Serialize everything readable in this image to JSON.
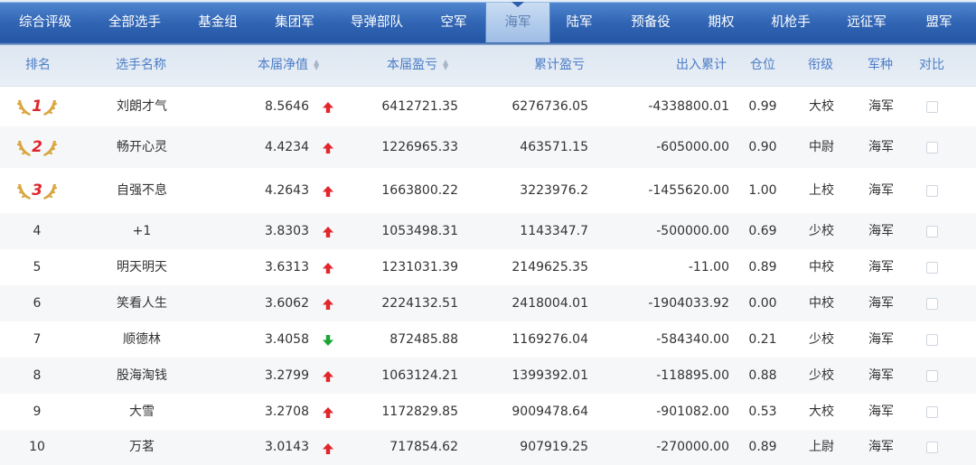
{
  "nav": {
    "items": [
      "综合评级",
      "全部选手",
      "基金组",
      "集团军",
      "导弹部队",
      "空军",
      "海军",
      "陆军",
      "预备役",
      "期权",
      "机枪手",
      "远征军",
      "盟军"
    ],
    "active_index": 6
  },
  "columns": {
    "rank": "排名",
    "name": "选手名称",
    "nav_value": "本届净值",
    "profit": "本届盈亏",
    "total_profit": "累计盈亏",
    "flow": "出入累计",
    "position": "仓位",
    "title": "衔级",
    "branch": "军种",
    "compare": "对比"
  },
  "rows": [
    {
      "rank": "1",
      "name": "刘朗才气",
      "nav": "8.5646",
      "trend": "up",
      "profit": "6412721.35",
      "total": "6276736.05",
      "flow": "-4338800.01",
      "pos": "0.99",
      "title": "大校",
      "branch": "海军"
    },
    {
      "rank": "2",
      "name": "畅开心灵",
      "nav": "4.4234",
      "trend": "up",
      "profit": "1226965.33",
      "total": "463571.15",
      "flow": "-605000.00",
      "pos": "0.90",
      "title": "中尉",
      "branch": "海军"
    },
    {
      "rank": "3",
      "name": "自强不息",
      "nav": "4.2643",
      "trend": "up",
      "profit": "1663800.22",
      "total": "3223976.2",
      "flow": "-1455620.00",
      "pos": "1.00",
      "title": "上校",
      "branch": "海军"
    },
    {
      "rank": "4",
      "name": "+1",
      "nav": "3.8303",
      "trend": "up",
      "profit": "1053498.31",
      "total": "1143347.7",
      "flow": "-500000.00",
      "pos": "0.69",
      "title": "少校",
      "branch": "海军"
    },
    {
      "rank": "5",
      "name": "明天明天",
      "nav": "3.6313",
      "trend": "up",
      "profit": "1231031.39",
      "total": "2149625.35",
      "flow": "-11.00",
      "pos": "0.89",
      "title": "中校",
      "branch": "海军"
    },
    {
      "rank": "6",
      "name": "笑看人生",
      "nav": "3.6062",
      "trend": "up",
      "profit": "2224132.51",
      "total": "2418004.01",
      "flow": "-1904033.92",
      "pos": "0.00",
      "title": "中校",
      "branch": "海军"
    },
    {
      "rank": "7",
      "name": "顺德林",
      "nav": "3.4058",
      "trend": "down",
      "profit": "872485.88",
      "total": "1169276.04",
      "flow": "-584340.00",
      "pos": "0.21",
      "title": "少校",
      "branch": "海军"
    },
    {
      "rank": "8",
      "name": "股海淘钱",
      "nav": "3.2799",
      "trend": "up",
      "profit": "1063124.21",
      "total": "1399392.01",
      "flow": "-118895.00",
      "pos": "0.88",
      "title": "少校",
      "branch": "海军"
    },
    {
      "rank": "9",
      "name": "大雪",
      "nav": "3.2708",
      "trend": "up",
      "profit": "1172829.85",
      "total": "9009478.64",
      "flow": "-901082.00",
      "pos": "0.53",
      "title": "大校",
      "branch": "海军"
    },
    {
      "rank": "10",
      "name": "万茗",
      "nav": "3.0143",
      "trend": "up",
      "profit": "717854.62",
      "total": "907919.25",
      "flow": "-270000.00",
      "pos": "0.89",
      "title": "上尉",
      "branch": "海军"
    }
  ],
  "colors": {
    "nav_bg": "#3266b5",
    "header_text": "#4d7ec7",
    "up_arrow": "#e2262b",
    "down_arrow": "#1aa636",
    "medal_gold": "#d9a640",
    "medal_number": "#e0262c"
  },
  "icons": {
    "up": "arrow-up-icon",
    "down": "arrow-down-icon",
    "sort": "sort-icon",
    "medal": "laurel-medal-icon"
  }
}
